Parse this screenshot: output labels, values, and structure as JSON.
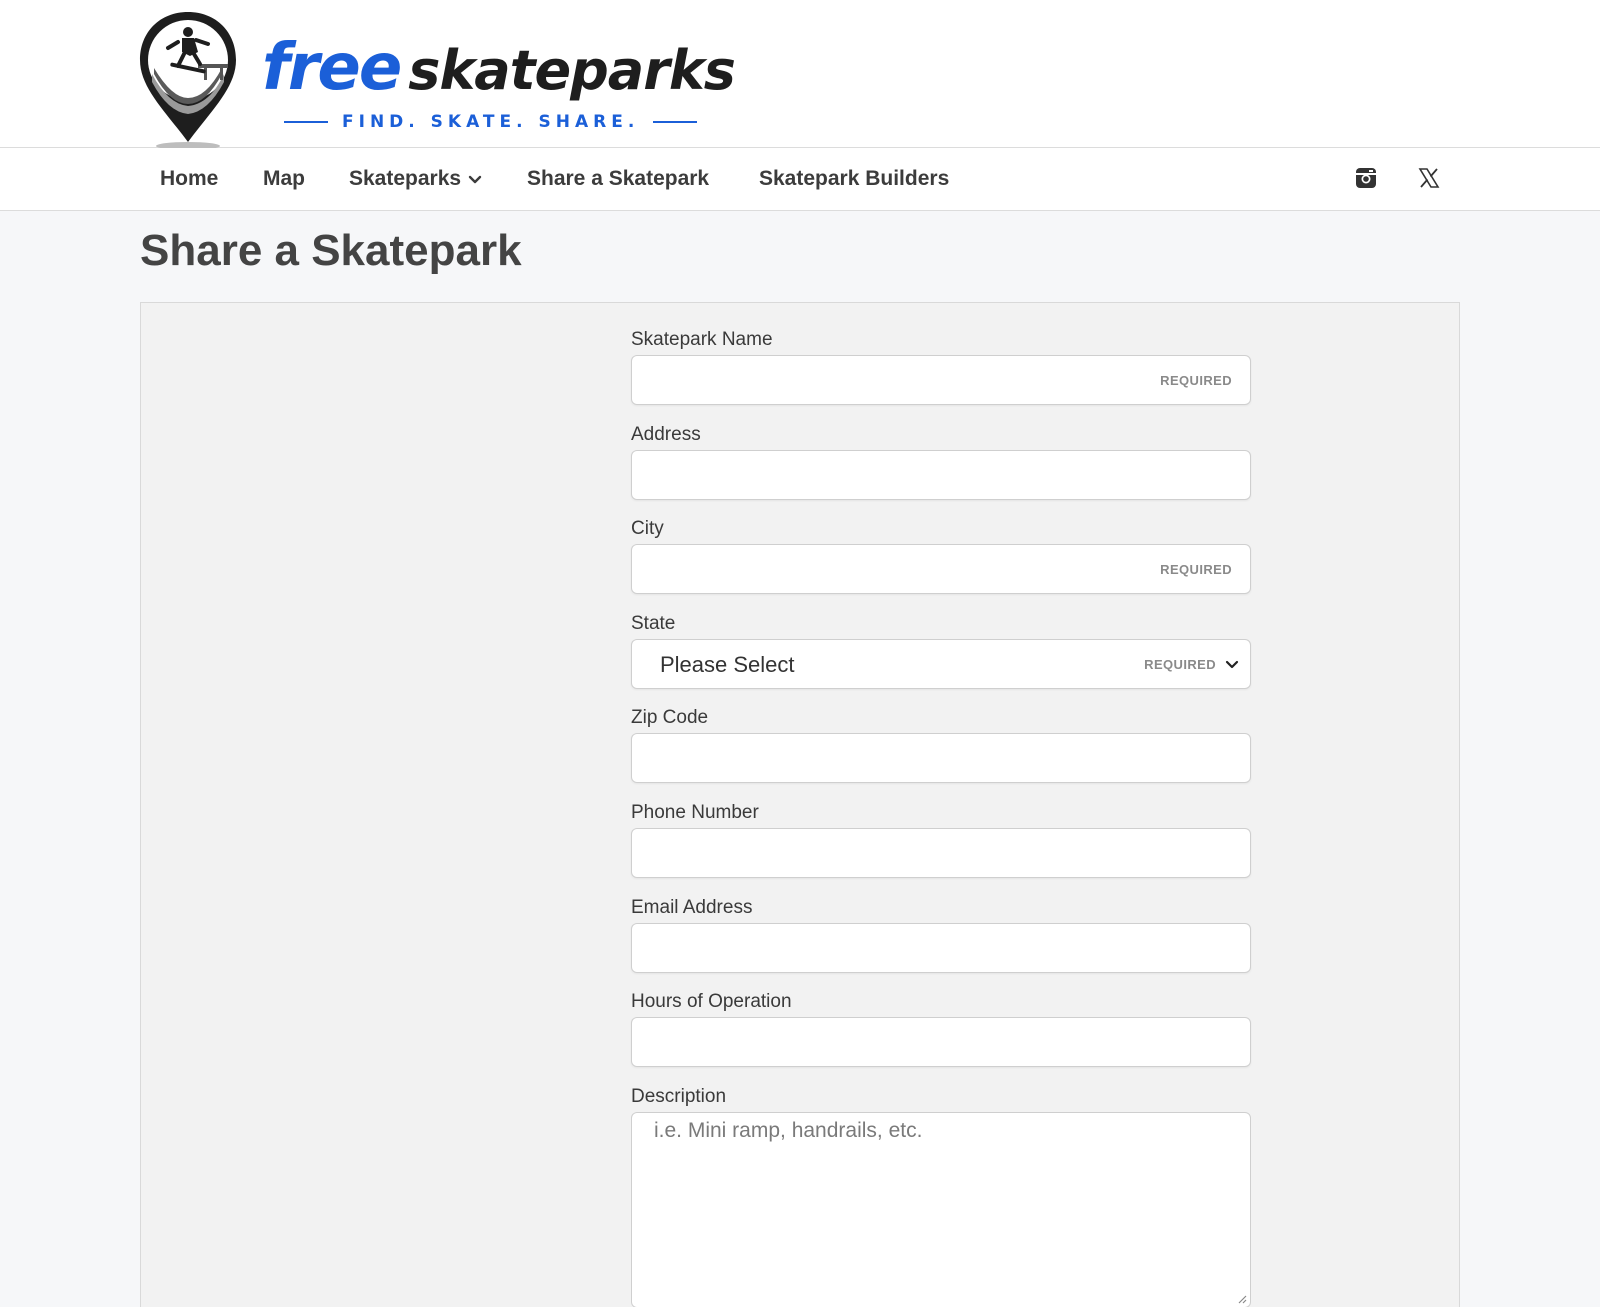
{
  "brand": {
    "word1": "free",
    "word2": "skateparks",
    "tagline": "FIND. SKATE. SHARE."
  },
  "nav": {
    "items": [
      {
        "label": "Home"
      },
      {
        "label": "Map"
      },
      {
        "label": "Skateparks",
        "has_dropdown": true
      },
      {
        "label": "Share a Skatepark"
      },
      {
        "label": "Skatepark Builders"
      }
    ],
    "social": [
      "instagram-icon",
      "x-icon"
    ]
  },
  "page": {
    "title": "Share a Skatepark"
  },
  "form": {
    "required_badge": "REQUIRED",
    "fields": {
      "name": {
        "label": "Skatepark Name",
        "value": ""
      },
      "address": {
        "label": "Address",
        "value": ""
      },
      "city": {
        "label": "City",
        "value": ""
      },
      "state": {
        "label": "State",
        "selected": "Please Select"
      },
      "zip": {
        "label": "Zip Code",
        "value": ""
      },
      "phone": {
        "label": "Phone Number",
        "value": ""
      },
      "email": {
        "label": "Email Address",
        "value": ""
      },
      "hours": {
        "label": "Hours of Operation",
        "value": ""
      },
      "description": {
        "label": "Description",
        "placeholder": "i.e. Mini ramp, handrails, etc."
      }
    }
  },
  "colors": {
    "brand_blue": "#1b5fd8",
    "page_bg": "#f6f7f9",
    "panel_bg": "#f2f2f2"
  }
}
